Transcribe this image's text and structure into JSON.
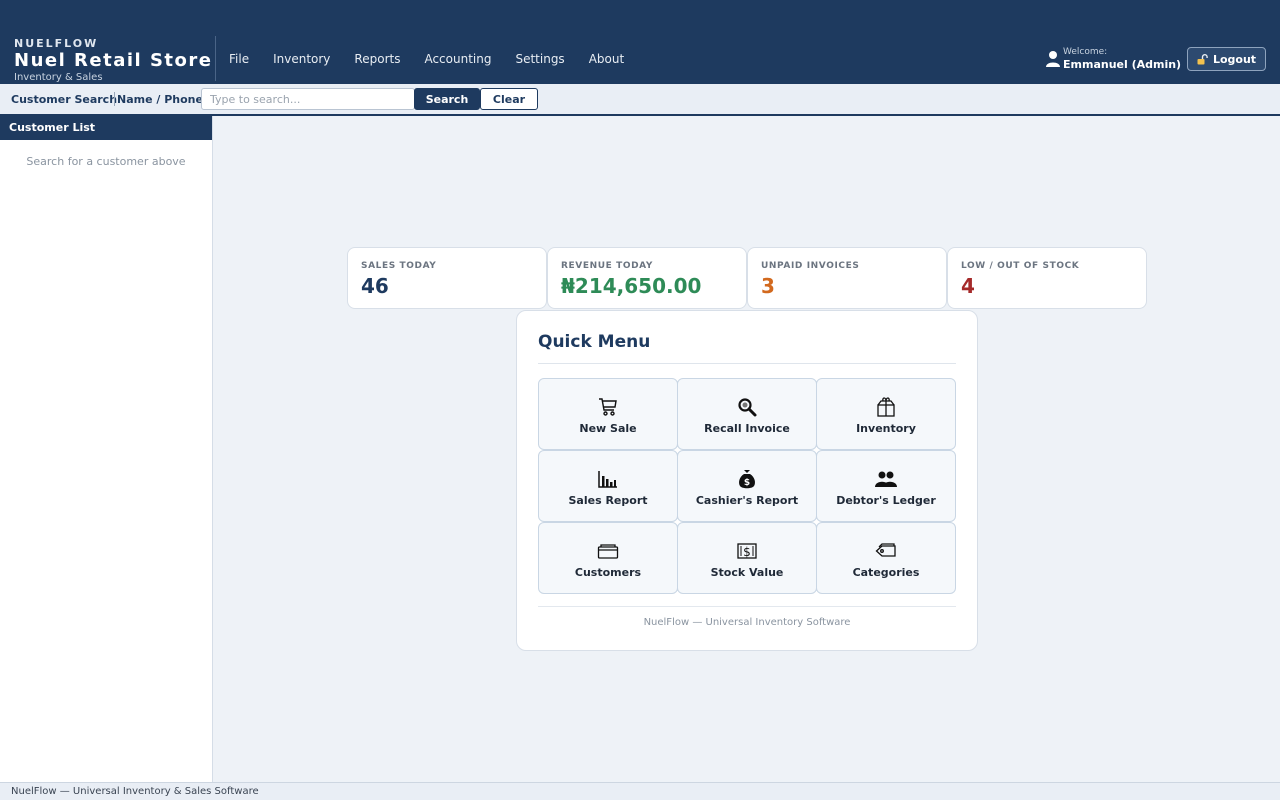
{
  "brand": {
    "small": "NUELFLOW",
    "title": "Nuel Retail Store",
    "subtitle": "Inventory & Sales"
  },
  "menu": [
    "File",
    "Inventory",
    "Reports",
    "Accounting",
    "Settings",
    "About"
  ],
  "user": {
    "welcome": "Welcome:",
    "name": "Emmanuel (Admin)",
    "logout_label": "Logout"
  },
  "search": {
    "label": "Customer Search",
    "mode": "Name / Phone",
    "placeholder": "Type to search...",
    "value": "",
    "search_label": "Search",
    "clear_label": "Clear"
  },
  "sidebar": {
    "title": "Customer List",
    "empty": "Search for a customer above"
  },
  "stats": [
    {
      "label": "SALES TODAY",
      "value": "46",
      "color": "#1e3a5f"
    },
    {
      "label": "REVENUE TODAY",
      "value": "₦214,650.00",
      "color": "#2e8b57"
    },
    {
      "label": "UNPAID INVOICES",
      "value": "3",
      "color": "#d2691e"
    },
    {
      "label": "LOW / OUT OF STOCK",
      "value": "4",
      "color": "#a52a2a"
    }
  ],
  "quick_menu": {
    "title": "Quick Menu",
    "tiles": [
      {
        "label": "New Sale",
        "icon": "cart-icon"
      },
      {
        "label": "Recall Invoice",
        "icon": "magnifier-icon"
      },
      {
        "label": "Inventory",
        "icon": "package-icon"
      },
      {
        "label": "Sales Report",
        "icon": "bar-chart-icon"
      },
      {
        "label": "Cashier's Report",
        "icon": "money-bag-icon"
      },
      {
        "label": "Debtor's Ledger",
        "icon": "people-icon"
      },
      {
        "label": "Customers",
        "icon": "card-index-icon"
      },
      {
        "label": "Stock Value",
        "icon": "dollar-banknote-icon"
      },
      {
        "label": "Categories",
        "icon": "tag-icon"
      }
    ],
    "footer": "NuelFlow — Universal Inventory Software"
  },
  "footer": "NuelFlow — Universal Inventory & Sales Software",
  "colors": {
    "primary": "#1e3a5f",
    "background": "#eef2f7"
  }
}
